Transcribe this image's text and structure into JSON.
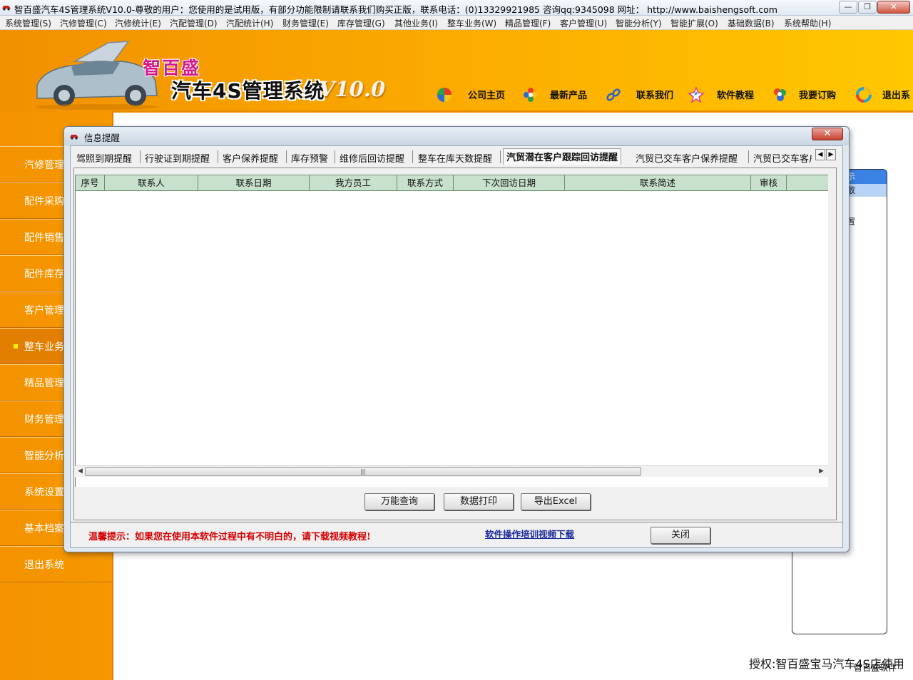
{
  "window": {
    "title": "智百盛汽车4S管理系统V10.0-尊敬的用户：您使用的是试用版，有部分功能限制请联系我们购买正版，联系电话：(0)13329921985  咨询qq:9345098   网址：  http://www.baishengsoft.com",
    "minimize": "—",
    "maximize": "❐",
    "close": "✕"
  },
  "menu": [
    "系统管理(S)",
    "汽修管理(C)",
    "汽修统计(E)",
    "汽配管理(D)",
    "汽配统计(H)",
    "财务管理(E)",
    "库存管理(G)",
    "其他业务(I)",
    "整车业务(W)",
    "精品管理(F)",
    "客户管理(U)",
    "智能分析(Y)",
    "智能扩展(O)",
    "基础数据(B)",
    "系统帮助(H)"
  ],
  "logo": {
    "line1": "智百盛",
    "line2": "汽车4S管理系统",
    "version": "V10.0"
  },
  "nav": [
    "公司主页",
    "最新产品",
    "联系我们",
    "软件教程",
    "我要订购",
    "退出系"
  ],
  "sidebar": [
    "汽修管理",
    "配件采购",
    "配件销售",
    "配件库存",
    "客户管理",
    "整车业务",
    "精品管理",
    "财务管理",
    "智能分析",
    "系统设置",
    "基本档案",
    "退出系统"
  ],
  "right_panel": {
    "item1": "示",
    "item2": "散",
    "item3": "置"
  },
  "license": {
    "text": "授权:智百盛宝马汽车4S店使用",
    "company": "智百盛软件"
  },
  "dialog": {
    "title": "信息提醒",
    "close": "✕",
    "tabs": [
      "驾照到期提醒",
      "行驶证到期提醒",
      "客户保养提醒",
      "库存预警",
      "维修后回访提醒",
      "整车在库天数提醒",
      "汽贸潜在客户跟踪回访提醒",
      "汽贸已交车客户保养提醒",
      "汽贸已交车客户"
    ],
    "active_tab": "汽贸潜在客户跟踪回访提醒",
    "columns": [
      "序号",
      "联系人",
      "联系日期",
      "我方员工",
      "联系方式",
      "下次回访日期",
      "联系简述",
      "审核",
      ""
    ],
    "buttons": {
      "query": "万能查询",
      "print": "数据打印",
      "export": "导出Excel",
      "close": "关闭"
    },
    "tip": "温馨提示：如果您在使用本软件过程中有不明白的，请下载视频教程!",
    "link": "软件操作培训视频下载"
  },
  "colors": {
    "orange": "#f9a400",
    "grid_header": "#c8e1cc",
    "tip": "#d40000",
    "link": "#1a2a9a"
  }
}
